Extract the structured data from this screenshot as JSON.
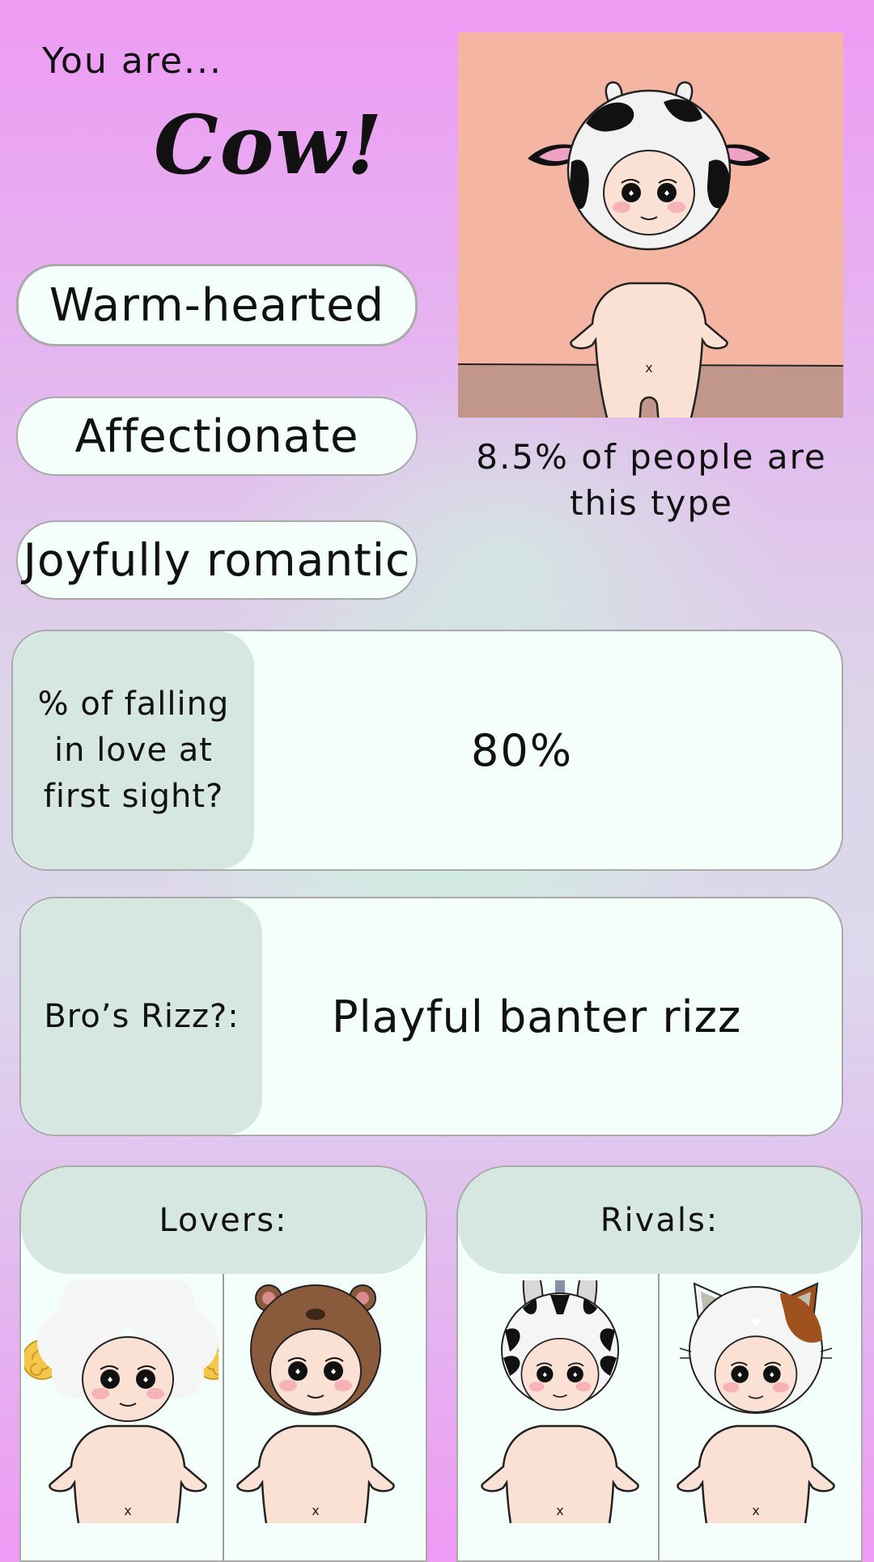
{
  "result": {
    "intro": "You are...",
    "type_name": "Cow!",
    "traits": [
      "Warm-hearted",
      "Affectionate",
      "Joyfully romantic"
    ],
    "percent_text": "8.5% of people are this type"
  },
  "stats": [
    {
      "label": "% of falling in love at first sight?",
      "value": "80%"
    },
    {
      "label": "Bro’s Rizz?:",
      "value": "Playful banter rizz"
    }
  ],
  "matches": {
    "lovers_label": "Lovers:",
    "rivals_label": "Rivals:",
    "lovers": [
      "sheep",
      "bear"
    ],
    "rivals": [
      "zebra",
      "cat"
    ]
  },
  "colors": {
    "card_bg": "#f4fffb",
    "label_bg": "#d6e7e2",
    "scene_bg": "#f4b6a2",
    "floor": "#c0978a",
    "skin": "#fbe1d3"
  }
}
